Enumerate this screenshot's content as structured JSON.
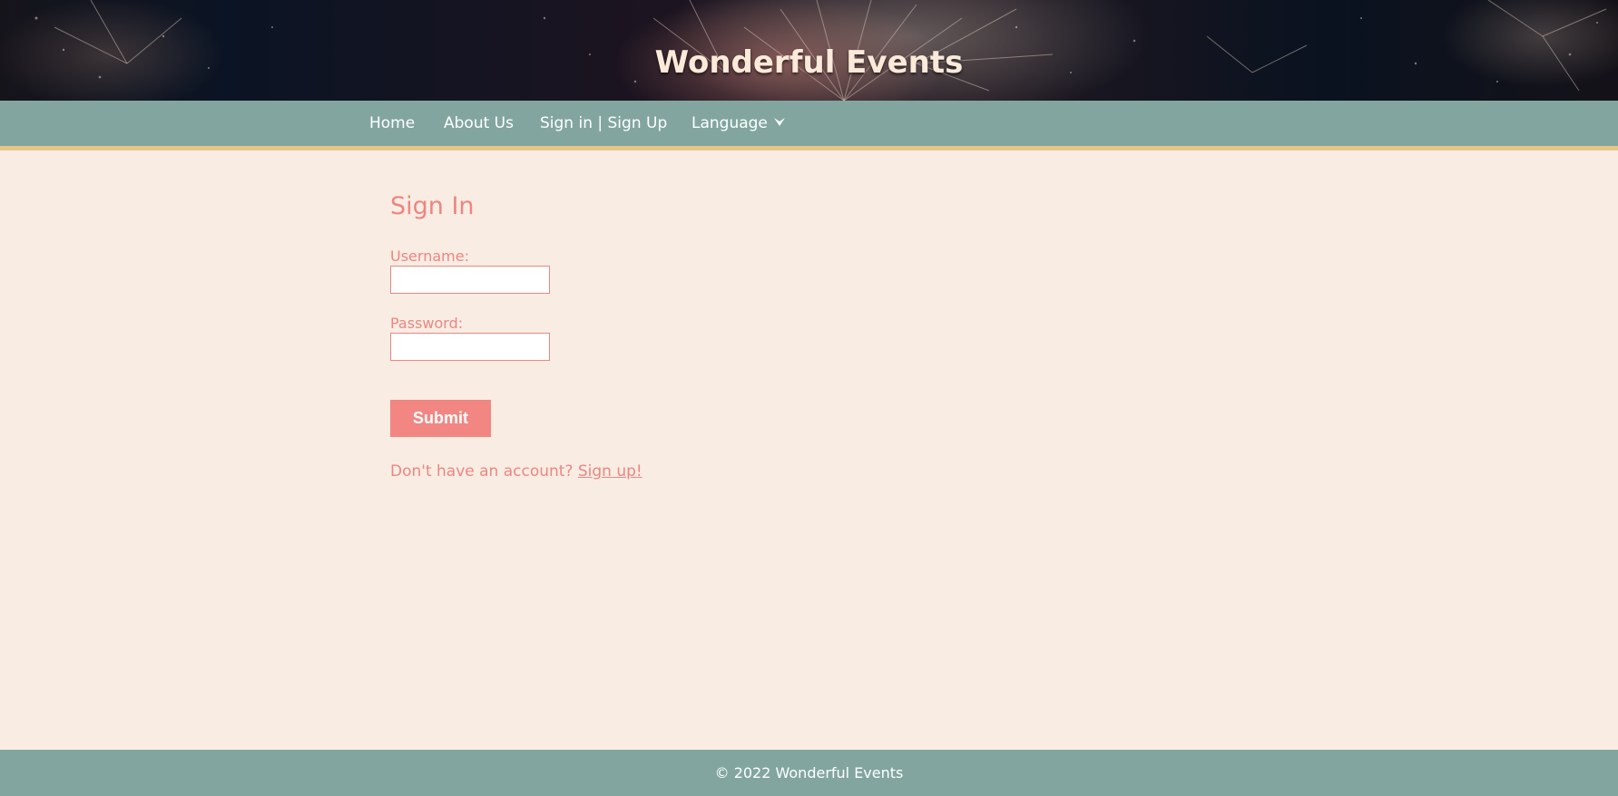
{
  "header": {
    "site_title": "Wonderful Events",
    "background": "fireworks-image"
  },
  "nav": {
    "items": [
      {
        "label": "Home"
      },
      {
        "label": "About Us"
      },
      {
        "label": "Sign in | Sign Up"
      },
      {
        "label": "Language"
      }
    ],
    "language_icon": "chevron-down-icon"
  },
  "signin": {
    "heading": "Sign In",
    "username_label": "Username:",
    "username_value": "",
    "password_label": "Password:",
    "password_value": "",
    "submit_label": "Submit",
    "signup_prompt": "Don't have an account? ",
    "signup_link": "Sign up!"
  },
  "footer": {
    "text": "© 2022 Wonderful Events"
  },
  "colors": {
    "page_background": "#f9ede3",
    "nav_background": "#82a69f",
    "nav_border": "#e7c58a",
    "accent": "#ee8581",
    "button": "#f28683",
    "title_text": "#fbead9"
  }
}
